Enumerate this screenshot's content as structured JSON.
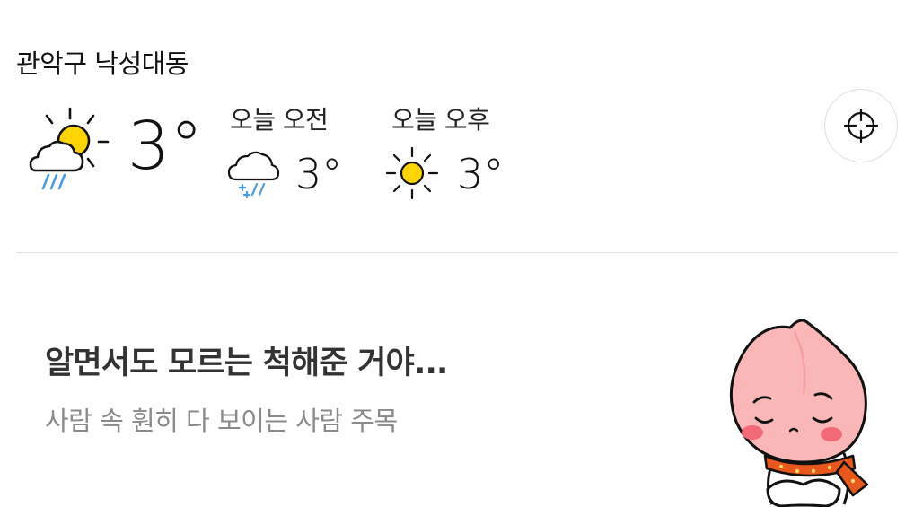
{
  "weather": {
    "location": "관악구 낙성대동",
    "current": {
      "temp": "3°",
      "icon": "sun-cloud-rain-icon"
    },
    "forecast": [
      {
        "label": "오늘 오전",
        "temp": "3°",
        "icon": "cloud-sleet-icon"
      },
      {
        "label": "오늘 오후",
        "temp": "3°",
        "icon": "sun-icon"
      }
    ],
    "locate_icon": "crosshair-icon"
  },
  "content_card": {
    "title": "알면서도 모르는 척해준 거야...",
    "subtitle": "사람 속 훤히 다 보이는 사람 주목",
    "image": "apeach-character-illustration"
  },
  "colors": {
    "sun": "#FFD400",
    "rain": "#4A9BE0",
    "divider": "#E2E2E2",
    "title": "#333333",
    "subtitle": "#8A8A8A",
    "character_pink": "#F9B7B8",
    "scarf_orange": "#E8571C"
  }
}
